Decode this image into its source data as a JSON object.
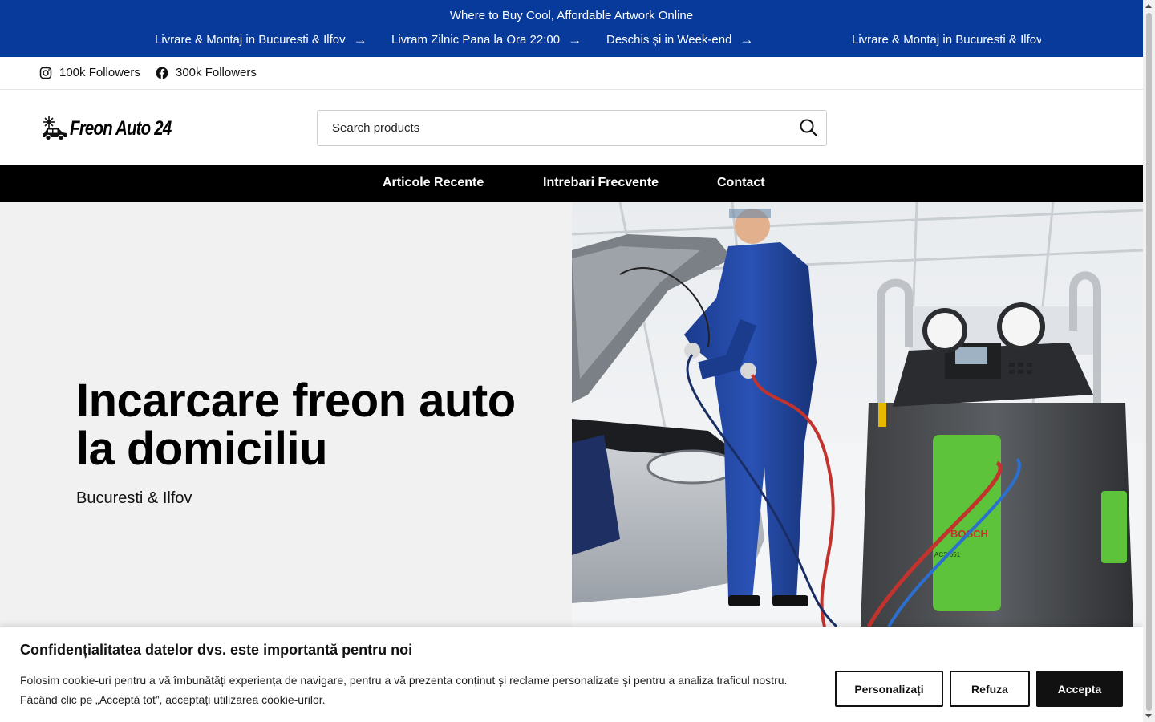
{
  "topbar": {
    "title": "Where to Buy Cool, Affordable Artwork Online",
    "ticker": [
      "Livrare & Montaj in Bucuresti & Ilfov",
      "Livram Zilnic Pana la Ora 22:00",
      "Deschis și in Week-end",
      "Livrare & Montaj in Bucuresti & Ilfov"
    ]
  },
  "social": {
    "instagram": "100k Followers",
    "facebook": "300k Followers"
  },
  "header": {
    "logo_text": "Freon Auto 24",
    "search_placeholder": "Search products"
  },
  "nav": {
    "items": [
      "Articole Recente",
      "Intrebari Frecvente",
      "Contact"
    ]
  },
  "hero": {
    "title": "Incarcare freon auto la domiciliu",
    "subtitle": "Bucuresti & Ilfov",
    "brand_on_machine": "BOSCH",
    "model_on_machine": "ACS 651"
  },
  "cookie": {
    "title": "Confidențialitatea datelor dvs. este importantă pentru noi",
    "text": "Folosim cookie-uri pentru a vă îmbunătăți experiența de navigare, pentru a vă prezenta conținut și reclame personalizate și pentru a analiza traficul nostru. Făcând clic pe „Acceptă tot”, acceptați utilizarea cookie-urilor.",
    "customize": "Personalizați",
    "reject": "Refuza",
    "accept": "Accepta"
  },
  "colors": {
    "topbar_bg": "#073a9a",
    "nav_bg": "#000000",
    "hero_bg": "#f1f1f1",
    "machine_green": "#5cc33a"
  }
}
